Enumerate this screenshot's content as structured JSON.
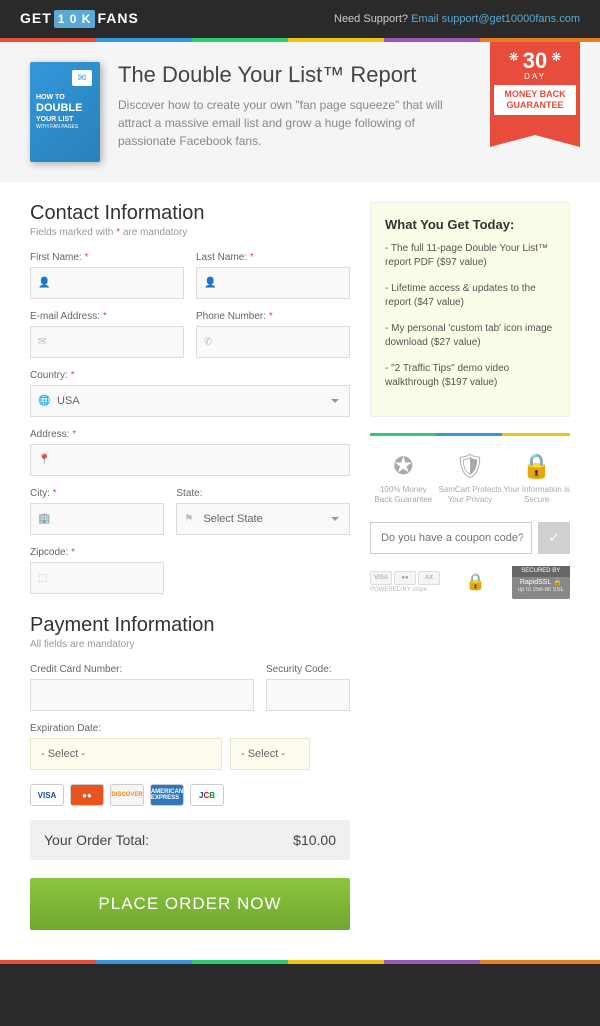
{
  "header": {
    "logo_pre": "GET",
    "logo_mid": "1 0 K",
    "logo_post": "FANS",
    "support_q": "Need Support?",
    "support_email": "Email support@get10000fans.com"
  },
  "hero": {
    "book_line1": "HOW TO",
    "book_line2": "DOUBLE",
    "book_line3": "YOUR LIST",
    "book_line4": "WITH FAN PAGES",
    "title": "The Double Your List™ Report",
    "desc": "Discover how to create your own \"fan page squeeze\" that will attract a massive email list and grow a huge following of passionate Facebook fans.",
    "ribbon_days": "30",
    "ribbon_day": "DAY",
    "ribbon_mb1": "MONEY BACK",
    "ribbon_mb2": "GUARANTEE"
  },
  "contact": {
    "heading": "Contact Information",
    "sub_pre": "Fields marked with ",
    "sub_post": " are mandatory",
    "first_name": "First Name:",
    "last_name": "Last Name:",
    "email": "E-mail Address:",
    "phone": "Phone Number:",
    "country": "Country:",
    "country_val": "USA",
    "address": "Address:",
    "city": "City:",
    "state": "State:",
    "state_val": "Select State",
    "zip": "Zipcode:"
  },
  "yget": {
    "heading": "What You Get Today:",
    "items": [
      "- The full 11-page Double Your List™ report PDF ($97 value)",
      "- Lifetime access & updates to the report ($47 value)",
      "- My personal 'custom tab' icon image download ($27 value)",
      "- \"2 Traffic Tips\" demo video walkthrough ($197 value)"
    ]
  },
  "badges": {
    "b1": "100% Money Back Guarantee",
    "b2": "SamCart Protects Your Privacy",
    "b3": "Your Information is Secure"
  },
  "coupon": {
    "placeholder": "Do you have a coupon code?"
  },
  "ssl": {
    "top": "SECURED BY",
    "mid": "RapidSSL 🔒",
    "bot": "up to 256-bit SSL"
  },
  "stripe_txt": "POWERED BY stripe",
  "payment": {
    "heading": "Payment Information",
    "sub": "All fields are mandatory",
    "ccnum": "Credit Card Number:",
    "seccode": "Security Code:",
    "expdate": "Expiration Date:",
    "select": "- Select -",
    "total_label": "Your Order Total:",
    "total_val": "$10.00",
    "button": "PLACE ORDER NOW"
  }
}
